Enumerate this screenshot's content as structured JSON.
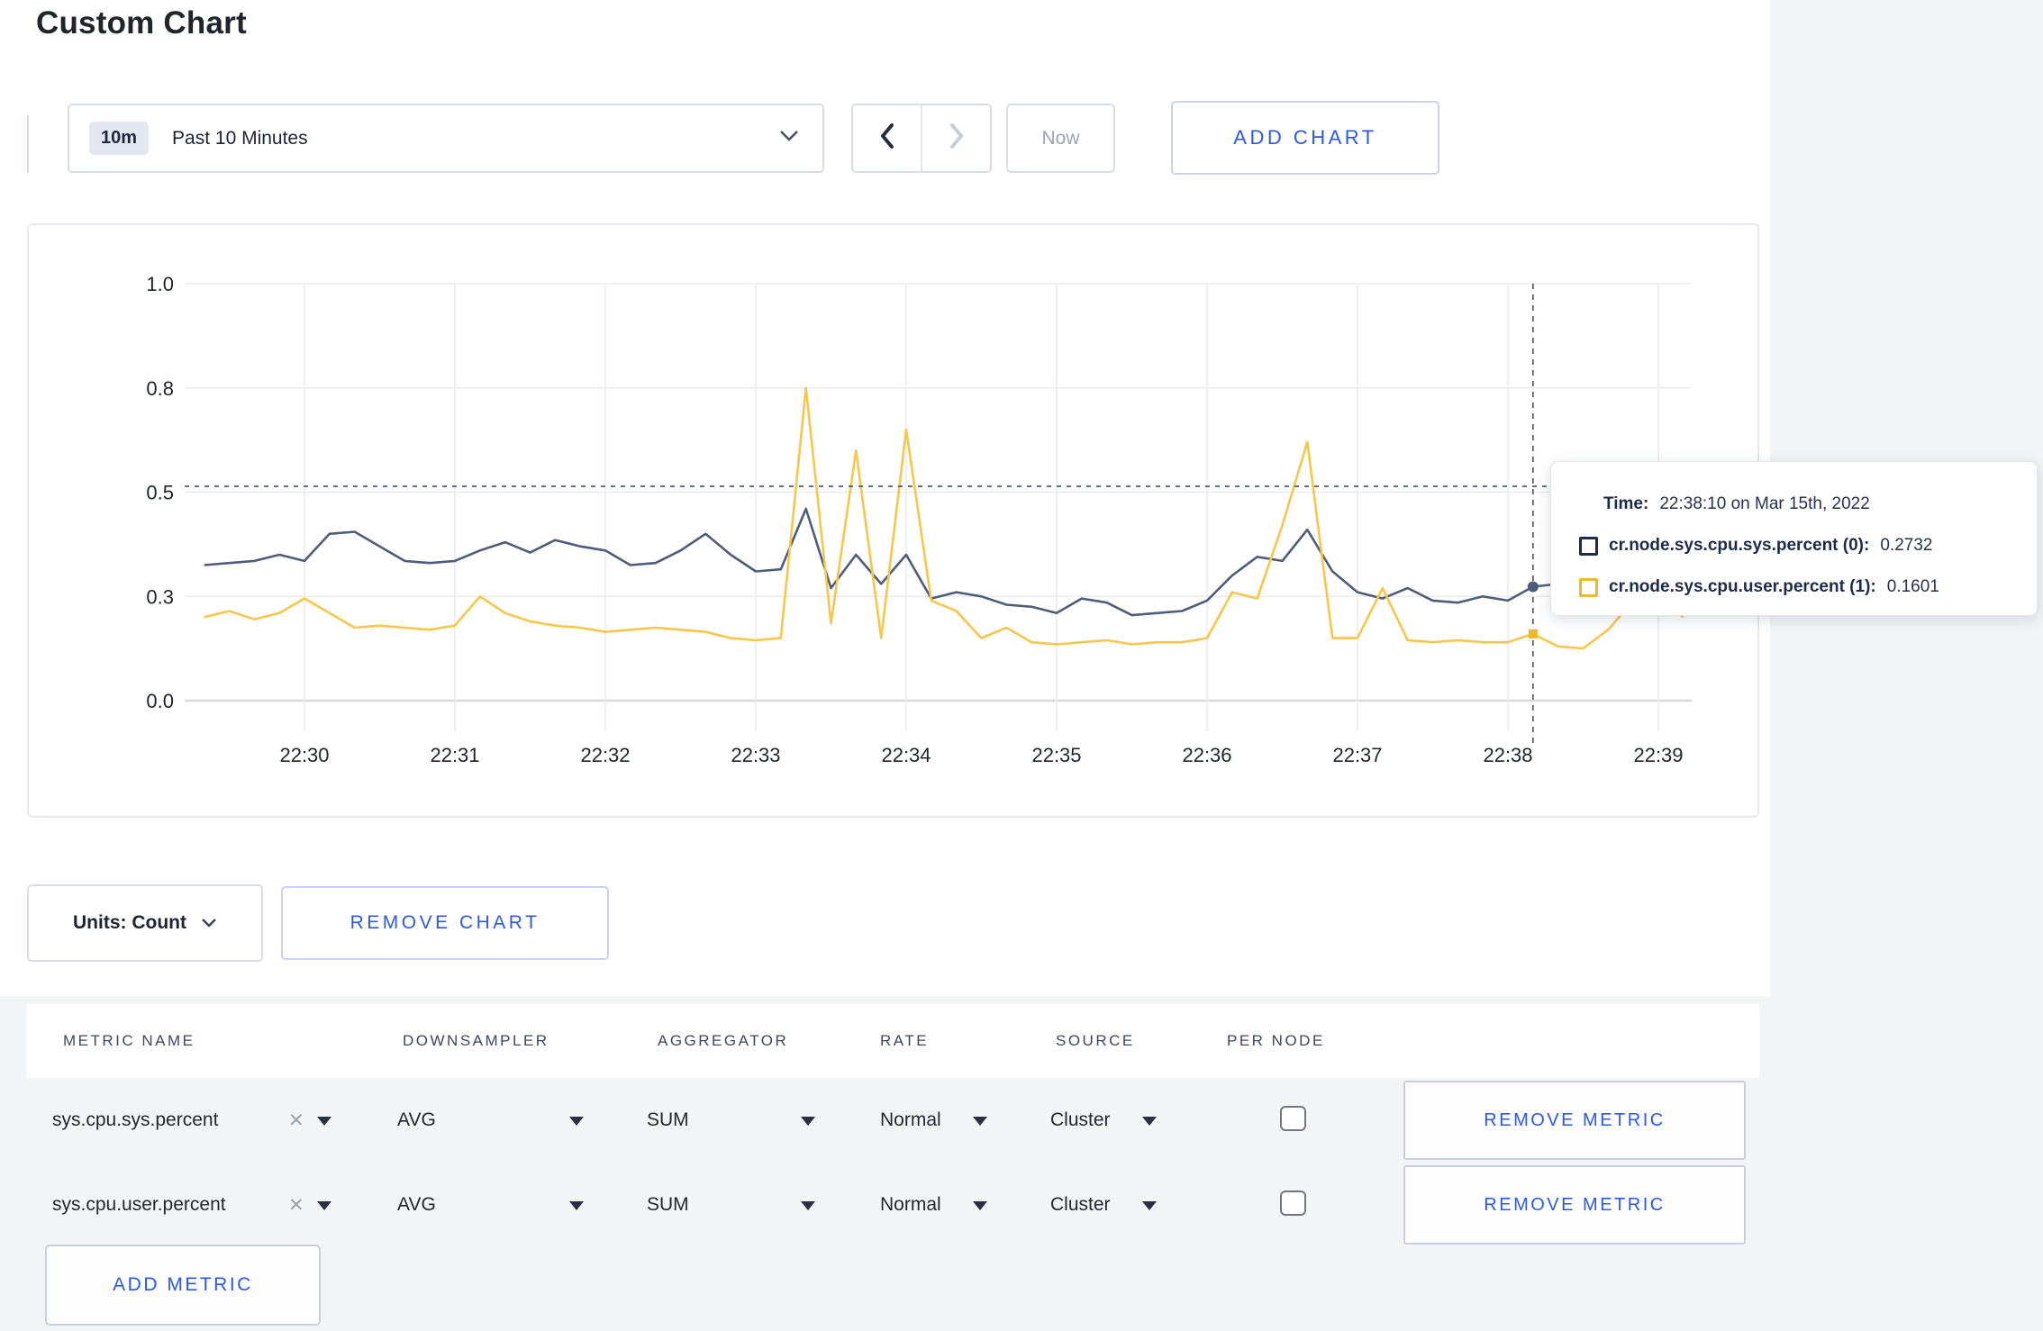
{
  "page": {
    "title": "Custom Chart"
  },
  "controls": {
    "time_badge": "10m",
    "time_label": "Past 10 Minutes",
    "now_label": "Now",
    "add_chart_label": "ADD CHART"
  },
  "tooltip": {
    "time_label": "Time:",
    "time_value": "22:38:10 on Mar 15th, 2022",
    "rows": [
      {
        "label": "cr.node.sys.cpu.sys.percent (0):",
        "value": "0.2732",
        "color": "#1e2c4c"
      },
      {
        "label": "cr.node.sys.cpu.user.percent (1):",
        "value": "0.1601",
        "color": "#f0b62f"
      }
    ]
  },
  "units": {
    "label": "Units: Count",
    "remove_chart_label": "REMOVE CHART"
  },
  "metrics": {
    "headers": [
      "METRIC NAME",
      "DOWNSAMPLER",
      "AGGREGATOR",
      "RATE",
      "SOURCE",
      "PER NODE"
    ],
    "rows": [
      {
        "name": "sys.cpu.sys.percent",
        "close": "✕",
        "downsampler": "AVG",
        "aggregator": "SUM",
        "rate": "Normal",
        "source": "Cluster",
        "per_node_checked": false,
        "remove_label": "REMOVE METRIC"
      },
      {
        "name": "sys.cpu.user.percent",
        "close": "✕",
        "downsampler": "AVG",
        "aggregator": "SUM",
        "rate": "Normal",
        "source": "Cluster",
        "per_node_checked": false,
        "remove_label": "REMOVE METRIC"
      }
    ],
    "add_label": "ADD METRIC"
  },
  "colors": {
    "accent_blue": "#2a58e8",
    "series_sys": "#4e5d79",
    "series_user": "#f7c64a",
    "crosshair": "#41506e",
    "grid": "#ebebeb",
    "axis_zero": "#d9d9d9"
  },
  "chart_data": {
    "type": "line",
    "title": "",
    "xlabel": "",
    "ylabel": "",
    "ylim": [
      0,
      1
    ],
    "grid": true,
    "legend_position": "none",
    "x_ticks": [
      "22:30",
      "22:31",
      "22:32",
      "22:33",
      "22:34",
      "22:35",
      "22:36",
      "22:37",
      "22:38",
      "22:39"
    ],
    "y_tick_labels": [
      "0.0",
      "0.3",
      "0.5",
      "0.8",
      "1.0"
    ],
    "y_tick_values": [
      0,
      0.25,
      0.5,
      0.75,
      1.0
    ],
    "times": [
      "22:29:20",
      "22:29:30",
      "22:29:40",
      "22:29:50",
      "22:30:00",
      "22:30:10",
      "22:30:20",
      "22:30:30",
      "22:30:40",
      "22:30:50",
      "22:31:00",
      "22:31:10",
      "22:31:20",
      "22:31:30",
      "22:31:40",
      "22:31:50",
      "22:32:00",
      "22:32:10",
      "22:32:20",
      "22:32:30",
      "22:32:40",
      "22:32:50",
      "22:33:00",
      "22:33:10",
      "22:33:20",
      "22:33:30",
      "22:33:40",
      "22:33:50",
      "22:34:00",
      "22:34:10",
      "22:34:20",
      "22:34:30",
      "22:34:40",
      "22:34:50",
      "22:35:00",
      "22:35:10",
      "22:35:20",
      "22:35:30",
      "22:35:40",
      "22:35:50",
      "22:36:00",
      "22:36:10",
      "22:36:20",
      "22:36:30",
      "22:36:40",
      "22:36:50",
      "22:37:00",
      "22:37:10",
      "22:37:20",
      "22:37:30",
      "22:37:40",
      "22:37:50",
      "22:38:00",
      "22:38:10",
      "22:38:20",
      "22:38:30",
      "22:38:40",
      "22:38:50",
      "22:39:00",
      "22:39:10"
    ],
    "series": [
      {
        "name": "cr.node.sys.cpu.sys.percent (0)",
        "color": "#4e5d79",
        "values": [
          0.325,
          0.33,
          0.335,
          0.35,
          0.335,
          0.4,
          0.405,
          0.37,
          0.335,
          0.33,
          0.335,
          0.36,
          0.38,
          0.355,
          0.385,
          0.37,
          0.36,
          0.325,
          0.33,
          0.36,
          0.4,
          0.35,
          0.31,
          0.315,
          0.46,
          0.27,
          0.35,
          0.28,
          0.35,
          0.245,
          0.26,
          0.25,
          0.23,
          0.225,
          0.21,
          0.245,
          0.235,
          0.205,
          0.21,
          0.215,
          0.24,
          0.3,
          0.345,
          0.335,
          0.41,
          0.31,
          0.26,
          0.245,
          0.27,
          0.24,
          0.235,
          0.25,
          0.24,
          0.2732,
          0.28,
          0.27,
          0.26,
          0.27,
          0.28,
          0.27
        ]
      },
      {
        "name": "cr.node.sys.cpu.user.percent (1)",
        "color": "#f7c64a",
        "values": [
          0.2,
          0.215,
          0.195,
          0.21,
          0.245,
          0.21,
          0.175,
          0.18,
          0.175,
          0.17,
          0.18,
          0.25,
          0.21,
          0.19,
          0.18,
          0.175,
          0.165,
          0.17,
          0.175,
          0.17,
          0.165,
          0.15,
          0.145,
          0.15,
          0.75,
          0.185,
          0.6,
          0.15,
          0.65,
          0.24,
          0.215,
          0.15,
          0.175,
          0.14,
          0.135,
          0.14,
          0.145,
          0.135,
          0.14,
          0.14,
          0.15,
          0.26,
          0.245,
          0.42,
          0.62,
          0.15,
          0.15,
          0.27,
          0.145,
          0.14,
          0.145,
          0.14,
          0.14,
          0.1601,
          0.13,
          0.125,
          0.17,
          0.24,
          0.245,
          0.2
        ]
      }
    ],
    "crosshair": {
      "time": "22:38:10",
      "hover_value": 0.514,
      "marker_values": [
        0.2732,
        0.1601
      ]
    }
  }
}
